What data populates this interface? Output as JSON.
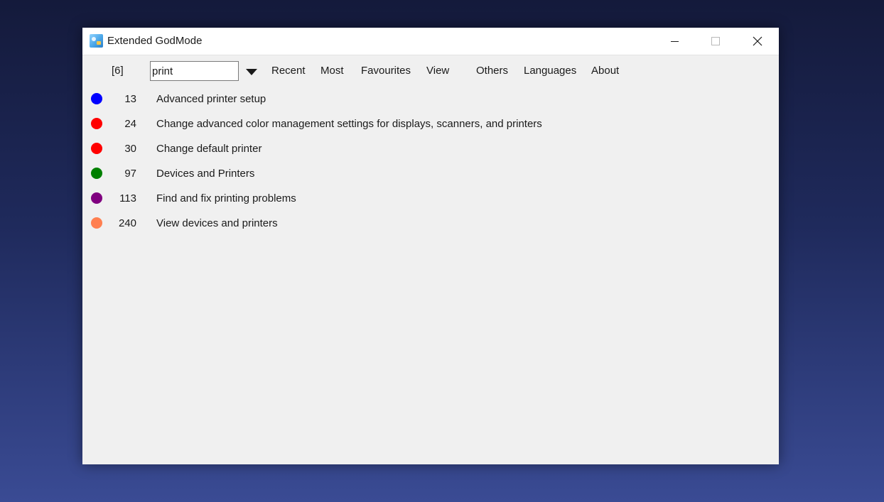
{
  "window": {
    "title": "Extended GodMode",
    "icon": "control-panel-icon"
  },
  "toolbar": {
    "result_count": "[6]",
    "search_value": "print",
    "dropdown_icon": "triangle-down-icon",
    "menu": [
      {
        "label": "Recent"
      },
      {
        "label": "Most"
      },
      {
        "label": "Favourites"
      },
      {
        "label": "View"
      },
      {
        "label": "Others"
      },
      {
        "label": "Languages"
      },
      {
        "label": "About"
      }
    ]
  },
  "results": [
    {
      "color": "#0000ff",
      "number": "13",
      "label": "Advanced printer setup"
    },
    {
      "color": "#ff0000",
      "number": "24",
      "label": "Change advanced color management settings for displays, scanners, and printers"
    },
    {
      "color": "#ff0000",
      "number": "30",
      "label": "Change default printer"
    },
    {
      "color": "#008000",
      "number": "97",
      "label": "Devices and Printers"
    },
    {
      "color": "#800080",
      "number": "113",
      "label": "Find and fix printing problems"
    },
    {
      "color": "#ff7f50",
      "number": "240",
      "label": "View devices and printers"
    }
  ]
}
